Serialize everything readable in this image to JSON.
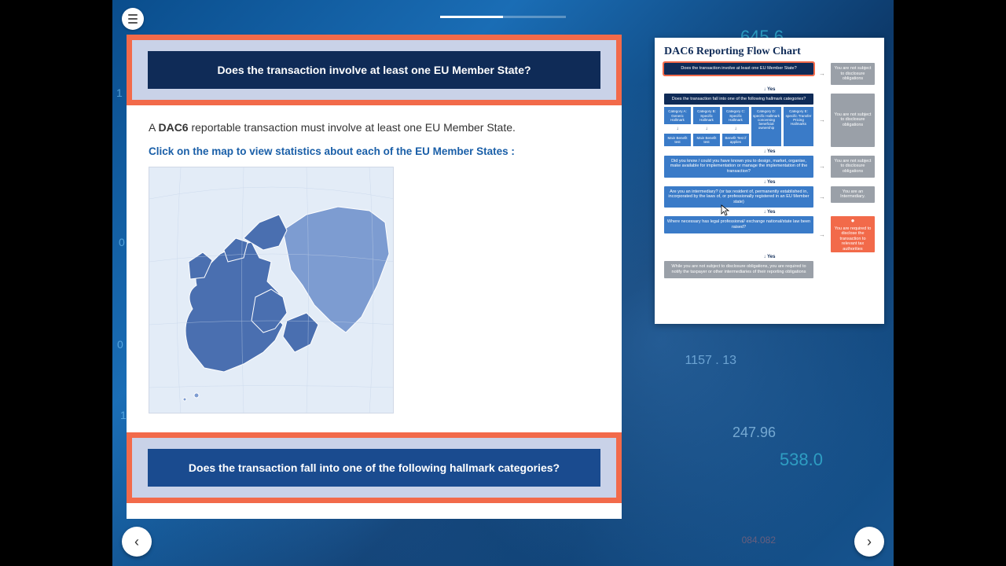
{
  "bgNumbers": {
    "a": "645.6",
    "b": "1157 . 13",
    "c": "247.96",
    "d": "538.0",
    "e": "1",
    "f": "0",
    "g": "0",
    "h": "1",
    "i": "084.082"
  },
  "question1": "Does the transaction involve at least one EU Member State?",
  "bodyPrefix": "A ",
  "bodyStrong": "DAC6",
  "bodySuffix": " reportable transaction must involve at least one EU Member State.",
  "instruction": "Click on the map to view statistics about each of the EU Member States :",
  "question2": "Does the transaction fall into one of the following hallmark categories?",
  "flow": {
    "title": "DAC6 Reporting Flow Chart",
    "step1": "Does the transaction involve at least one EU Member State?",
    "notSubject": "You are not subject to disclosure obligations",
    "yes": "Yes",
    "step2": "Does the transaction fall into one of the following hallmark categories?",
    "cats": [
      {
        "top": "Category A: Generic Hallmark",
        "bottom": "Main Benefit test"
      },
      {
        "top": "Category B: Specific Hallmark",
        "bottom": "Main Benefit test"
      },
      {
        "top": "Category C: Specific Hallmark",
        "bottom": "Benefit Test if applies"
      },
      {
        "top": "Category D: specific Hallmark concerning beneficial ownership",
        "bottom": ""
      },
      {
        "top": "Category E: specific Transfer Pricing Hallmarks",
        "bottom": ""
      }
    ],
    "step3": "Did you know / could you have known you to design, market, organise, make available for implementation or manage the implementation of the transaction?",
    "step4": "Are you an intermediary? (or tax resident of, permanently established in, incorporated by the laws of, or professionally registered in an EU Member state)",
    "notInter": "You are an Intermediary.",
    "step5": "Where necessary has legal professional/ exchange national/state law been raised?",
    "step6": "While you are not subject to disclosure obligations, you are required to notify the taxpayer or other intermediaries of their reporting obligations",
    "finalOrange": "You are required to disclose the transaction to relevant tax authorities"
  }
}
